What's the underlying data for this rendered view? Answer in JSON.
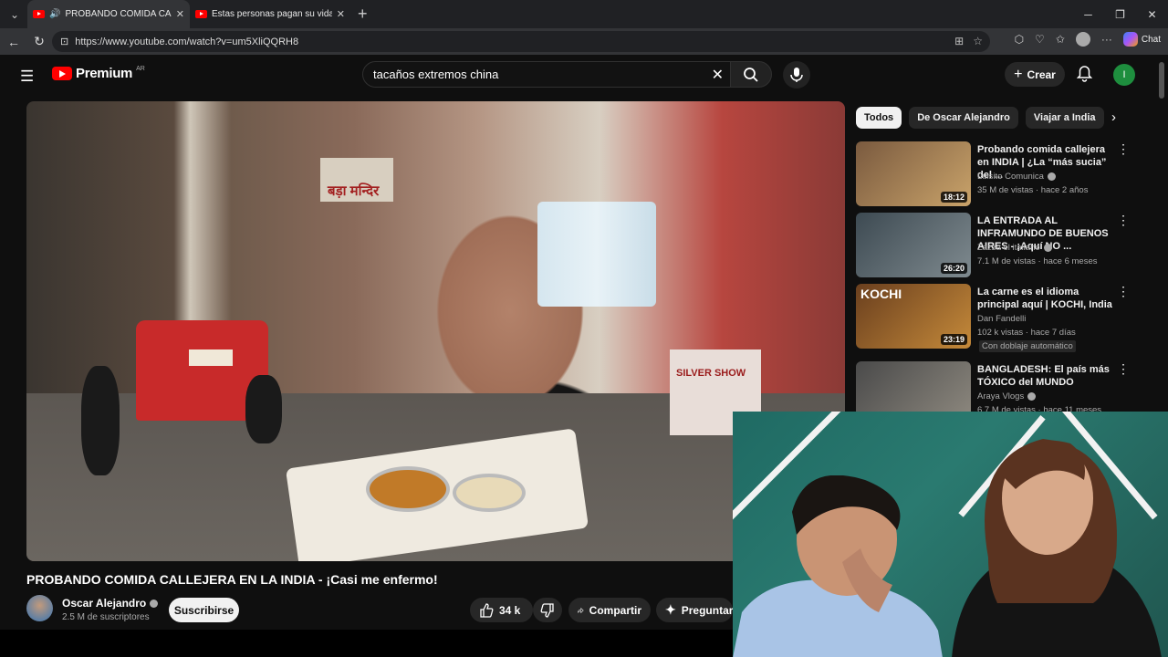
{
  "browser": {
    "tabs": [
      {
        "title": "PROBANDO COMIDA CALLEJERA EN LA INDIA",
        "active": true
      },
      {
        "title": "Estas personas pagan su vida con",
        "active": false
      }
    ],
    "url": "https://www.youtube.com/watch?v=um5XliQQRH8",
    "chat_label": "Chat"
  },
  "youtube": {
    "logo_text": "Premium",
    "logo_country": "AR",
    "search_query": "tacaños extremos china",
    "create_label": "Crear",
    "user_initial": "I",
    "video": {
      "title": "PROBANDO COMIDA CALLEJERA EN LA INDIA - ¡Casi me enfermo!",
      "channel": "Oscar Alejandro",
      "subscribers": "2.5 M de suscriptores",
      "subscribe_label": "Suscribirse",
      "likes": "34 k",
      "share_label": "Compartir",
      "ask_label": "Preguntar",
      "scene_sign": "बड़ा मन्दिर",
      "scene_card": "SILVER SHOW"
    },
    "chips": [
      "Todos",
      "De Oscar Alejandro",
      "Viajar a India"
    ],
    "recommendations": [
      {
        "title": "Probando comida callejera en INDIA | ¿La “más sucia” del ...",
        "channel": "Luisito Comunica",
        "verified": true,
        "meta": "35 M de vistas · hace 2 años",
        "duration": "18:12",
        "colors": [
          "#7a5a3f",
          "#c9a36a"
        ]
      },
      {
        "title": "LA ENTRADA AL INFRAMUNDO DE BUENOS AIRES - ¡Aquí NO ...",
        "channel": "Zazza el italiano",
        "verified": true,
        "meta": "7.1 M de vistas · hace 6 meses",
        "duration": "26:20",
        "colors": [
          "#3d4a52",
          "#7f8a8f"
        ]
      },
      {
        "title": "La carne es el idioma principal aquí | KOCHI, India",
        "channel": "Dan Fandelli",
        "verified": false,
        "meta": "102 k vistas · hace 7 días",
        "duration": "23:19",
        "badge": "Con doblaje automático",
        "thumb_text": "KOCHI",
        "colors": [
          "#6a3f1e",
          "#c58a3a"
        ]
      },
      {
        "title": "BANGLADESH: El país más TÓXICO del MUNDO",
        "channel": "Araya Vlogs",
        "verified": true,
        "meta": "6.7 M de vistas · hace 11 meses",
        "colors": [
          "#4a4a4a",
          "#8f8a80"
        ]
      }
    ]
  }
}
